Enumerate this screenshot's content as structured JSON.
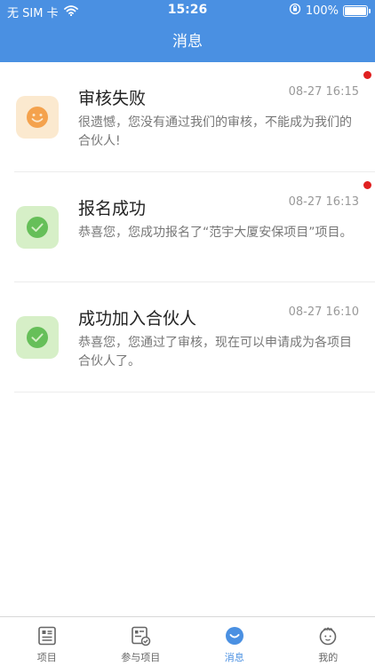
{
  "status_bar": {
    "carrier": "无 SIM 卡",
    "time": "15:26",
    "battery": "100%",
    "battery_level": 1.0
  },
  "nav": {
    "title": "消息"
  },
  "messages": [
    {
      "title": "审核失败",
      "time": "08-27 16:15",
      "text": "很遗憾，您没有通过我们的审核，不能成为我们的合伙人!",
      "icon": "smile-icon",
      "unread": true
    },
    {
      "title": "报名成功",
      "time": "08-27 16:13",
      "text": "恭喜您，您成功报名了“范宇大厦安保项目”项目。",
      "icon": "check-icon",
      "unread": true
    },
    {
      "title": "成功加入合伙人",
      "time": "08-27 16:10",
      "text": "恭喜您，您通过了审核，现在可以申请成为各项目合伙人了。",
      "icon": "check-icon",
      "unread": false
    }
  ],
  "tabs": [
    {
      "label": "项目",
      "icon": "document-icon",
      "active": false
    },
    {
      "label": "参与项目",
      "icon": "joined-project-icon",
      "active": false
    },
    {
      "label": "消息",
      "icon": "message-icon",
      "active": true
    },
    {
      "label": "我的",
      "icon": "profile-icon",
      "active": false
    }
  ],
  "colors": {
    "primary": "#4a90e2",
    "unread_dot": "#e02020",
    "warn_bg": "#fbe9cf",
    "warn": "#f4a24d",
    "ok_bg": "#d6efc7",
    "ok": "#66bf59"
  }
}
